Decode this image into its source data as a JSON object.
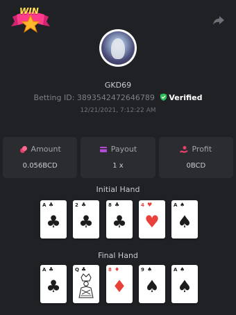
{
  "header": {
    "badge_text": "WIN"
  },
  "player": {
    "username": "GKD69",
    "betting_id_label": "Betting ID:",
    "betting_id": "3893542472646789",
    "verified_label": "Verified",
    "timestamp": "12/21/2021, 7:12:22 AM"
  },
  "stats": {
    "amount": {
      "label": "Amount",
      "value": "0.056BCD"
    },
    "payout": {
      "label": "Payout",
      "value": "1 x"
    },
    "profit": {
      "label": "Profit",
      "value": "0BCD"
    }
  },
  "initial_hand": {
    "title": "Initial Hand",
    "cards": [
      {
        "rank": "A",
        "suit": "♣",
        "color": "black"
      },
      {
        "rank": "2",
        "suit": "♣",
        "color": "black"
      },
      {
        "rank": "8",
        "suit": "♣",
        "color": "black"
      },
      {
        "rank": "4",
        "suit": "♥",
        "color": "red"
      },
      {
        "rank": "A",
        "suit": "♠",
        "color": "black"
      }
    ]
  },
  "final_hand": {
    "title": "Final Hand",
    "cards": [
      {
        "rank": "A",
        "suit": "♣",
        "color": "black"
      },
      {
        "rank": "Q",
        "suit": "♣",
        "color": "black"
      },
      {
        "rank": "8",
        "suit": "♦",
        "color": "red"
      },
      {
        "rank": "9",
        "suit": "♠",
        "color": "black"
      },
      {
        "rank": "A",
        "suit": "♠",
        "color": "black"
      }
    ]
  },
  "colors": {
    "background": "#1f2124",
    "panel": "#2a2c30",
    "accent_pink": "#e0406a",
    "verified_green": "#2fbf5a"
  }
}
